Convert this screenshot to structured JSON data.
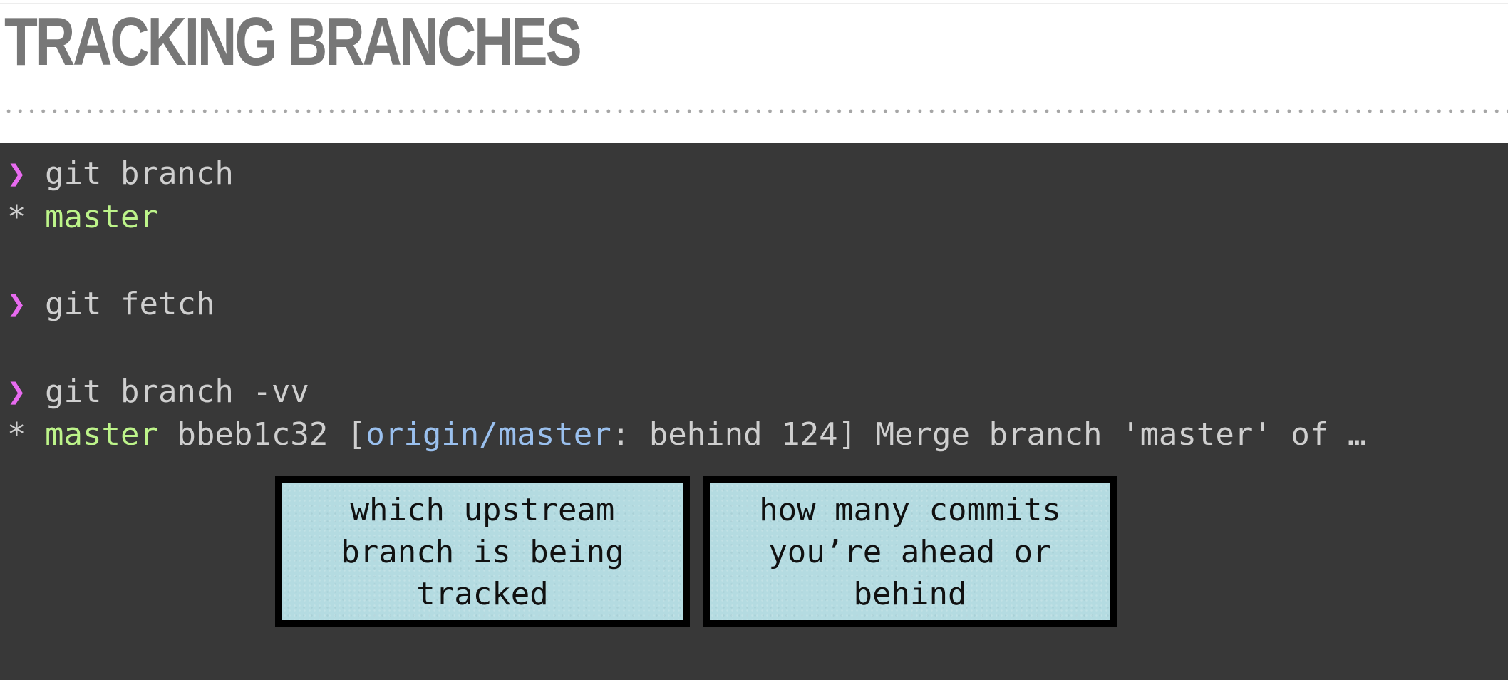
{
  "title": "TRACKING BRANCHES",
  "terminal": {
    "prompt_symbol": "❯",
    "cmd1": "git branch",
    "out1_star": "* ",
    "out1_branch": "master",
    "cmd2": "git fetch",
    "cmd3": "git branch -vv",
    "out3_star": "* ",
    "out3_branch": "master",
    "out3_hash_open": " bbeb1c32 [",
    "out3_remote": "origin/master",
    "out3_rest": ": behind 124] Merge branch 'master' of …"
  },
  "callouts": {
    "upstream": "which upstream\nbranch is being\ntracked",
    "ahead_behind": "how many commits\nyou’re ahead or\nbehind"
  },
  "colors": {
    "title": "#777777",
    "terminal_bg": "#383838",
    "prompt": "#e86bf0",
    "branch": "#bdf48a",
    "remote": "#9ac0ee",
    "callout_bg": "#b4dbe1"
  }
}
